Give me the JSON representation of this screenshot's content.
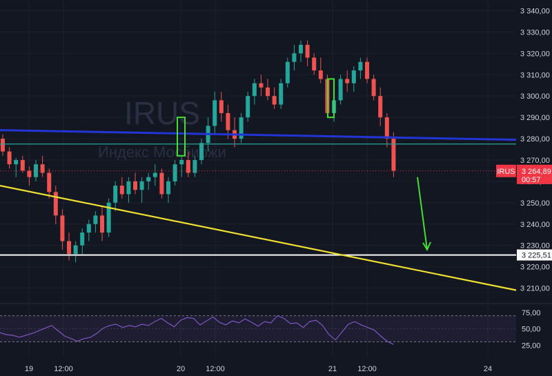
{
  "chart_data": {
    "type": "candlestick",
    "symbol": "IRUS",
    "watermark": {
      "symbol": "IRUS",
      "subtitle": "Индекс Мосбиржи"
    },
    "price_axis": {
      "ylim": [
        3205,
        3345
      ],
      "ticks": [
        "3 340,00",
        "3 330,00",
        "3 320,00",
        "3 310,00",
        "3 300,00",
        "3 290,00",
        "3 280,00",
        "3 270,00",
        "3 260,00",
        "3 250,00",
        "3 240,00",
        "3 230,00",
        "3 220,00",
        "3 210,00"
      ],
      "tick_values": [
        3340,
        3330,
        3320,
        3310,
        3300,
        3290,
        3280,
        3270,
        3260,
        3250,
        3240,
        3230,
        3220,
        3210
      ]
    },
    "time_axis": {
      "labels": [
        "19",
        "12:00",
        "20",
        "12:00",
        "21",
        "12:00",
        "24"
      ]
    },
    "current_price": {
      "value": 3264.89,
      "label": "3 264,89",
      "countdown": "00:57",
      "color": "#f23645"
    },
    "support_level": {
      "value": 3225.51,
      "label": "3 225,51",
      "color": "#ffffff"
    },
    "rsi": {
      "ylim": [
        20,
        78
      ],
      "ticks": [
        "75,00",
        "50,00",
        "25,00"
      ],
      "tick_values": [
        75,
        50,
        25
      ],
      "band": [
        30,
        70
      ],
      "color": "#7e57c2"
    },
    "drawings": [
      {
        "name": "blue-trendline",
        "color": "#2235d6"
      },
      {
        "name": "yellow-trendline",
        "color": "#f0e130"
      },
      {
        "name": "teal-horizontal-line",
        "color": "#26a69a"
      },
      {
        "name": "green-arrow",
        "color": "#43e033"
      },
      {
        "name": "green-rectangle-1",
        "color": "#43e033"
      },
      {
        "name": "green-rectangle-2",
        "color": "#43e033"
      }
    ],
    "colors": {
      "up": "#26a69a",
      "down": "#ef5350",
      "background": "#131722",
      "grid": "#1e2230"
    },
    "candles": [
      [
        3280,
        3282,
        3272,
        3274
      ],
      [
        3274,
        3276,
        3266,
        3268
      ],
      [
        3268,
        3271,
        3262,
        3270
      ],
      [
        3270,
        3272,
        3264,
        3265
      ],
      [
        3265,
        3267,
        3258,
        3262
      ],
      [
        3262,
        3270,
        3260,
        3268
      ],
      [
        3268,
        3272,
        3262,
        3264
      ],
      [
        3264,
        3266,
        3252,
        3255
      ],
      [
        3255,
        3258,
        3240,
        3244
      ],
      [
        3244,
        3247,
        3228,
        3232
      ],
      [
        3232,
        3236,
        3223,
        3226
      ],
      [
        3226,
        3232,
        3222,
        3230
      ],
      [
        3230,
        3238,
        3226,
        3236
      ],
      [
        3236,
        3242,
        3232,
        3240
      ],
      [
        3240,
        3246,
        3236,
        3244
      ],
      [
        3244,
        3248,
        3232,
        3236
      ],
      [
        3236,
        3252,
        3234,
        3250
      ],
      [
        3250,
        3260,
        3246,
        3258
      ],
      [
        3258,
        3262,
        3252,
        3254
      ],
      [
        3254,
        3262,
        3250,
        3260
      ],
      [
        3260,
        3264,
        3254,
        3256
      ],
      [
        3256,
        3262,
        3250,
        3260
      ],
      [
        3260,
        3264,
        3256,
        3262
      ],
      [
        3262,
        3268,
        3258,
        3264
      ],
      [
        3264,
        3266,
        3252,
        3254
      ],
      [
        3254,
        3262,
        3250,
        3260
      ],
      [
        3260,
        3270,
        3258,
        3268
      ],
      [
        3268,
        3272,
        3262,
        3270
      ],
      [
        3270,
        3274,
        3262,
        3264
      ],
      [
        3264,
        3272,
        3262,
        3270
      ],
      [
        3270,
        3280,
        3268,
        3278
      ],
      [
        3278,
        3290,
        3274,
        3286
      ],
      [
        3286,
        3302,
        3282,
        3298
      ],
      [
        3298,
        3302,
        3288,
        3292
      ],
      [
        3292,
        3296,
        3280,
        3284
      ],
      [
        3284,
        3290,
        3276,
        3280
      ],
      [
        3280,
        3292,
        3278,
        3290
      ],
      [
        3290,
        3302,
        3288,
        3300
      ],
      [
        3300,
        3308,
        3296,
        3306
      ],
      [
        3306,
        3310,
        3300,
        3304
      ],
      [
        3304,
        3308,
        3298,
        3300
      ],
      [
        3300,
        3304,
        3294,
        3296
      ],
      [
        3296,
        3308,
        3294,
        3306
      ],
      [
        3306,
        3318,
        3304,
        3316
      ],
      [
        3316,
        3324,
        3312,
        3320
      ],
      [
        3320,
        3326,
        3316,
        3324
      ],
      [
        3324,
        3326,
        3314,
        3318
      ],
      [
        3318,
        3320,
        3310,
        3312
      ],
      [
        3312,
        3318,
        3306,
        3308
      ],
      [
        3308,
        3310,
        3290,
        3292
      ],
      [
        3292,
        3300,
        3288,
        3298
      ],
      [
        3298,
        3310,
        3296,
        3308
      ],
      [
        3308,
        3312,
        3302,
        3306
      ],
      [
        3306,
        3314,
        3302,
        3312
      ],
      [
        3312,
        3318,
        3308,
        3316
      ],
      [
        3316,
        3318,
        3306,
        3308
      ],
      [
        3308,
        3310,
        3298,
        3300
      ],
      [
        3300,
        3304,
        3286,
        3290
      ],
      [
        3290,
        3292,
        3276,
        3280
      ],
      [
        3280,
        3283,
        3262,
        3265
      ]
    ],
    "rsi_values": [
      44,
      41,
      40,
      37,
      40,
      43,
      47,
      51,
      55,
      47,
      39,
      35,
      31,
      35,
      37,
      43,
      51,
      55,
      57,
      52,
      55,
      53,
      57,
      55,
      61,
      66,
      59,
      53,
      63,
      67,
      66,
      56,
      62,
      68,
      60,
      56,
      62,
      59,
      65,
      60,
      54,
      61,
      59,
      70,
      66,
      58,
      59,
      52,
      61,
      63,
      55,
      41,
      33,
      45,
      57,
      61,
      56,
      52,
      48,
      39,
      31,
      26
    ]
  }
}
